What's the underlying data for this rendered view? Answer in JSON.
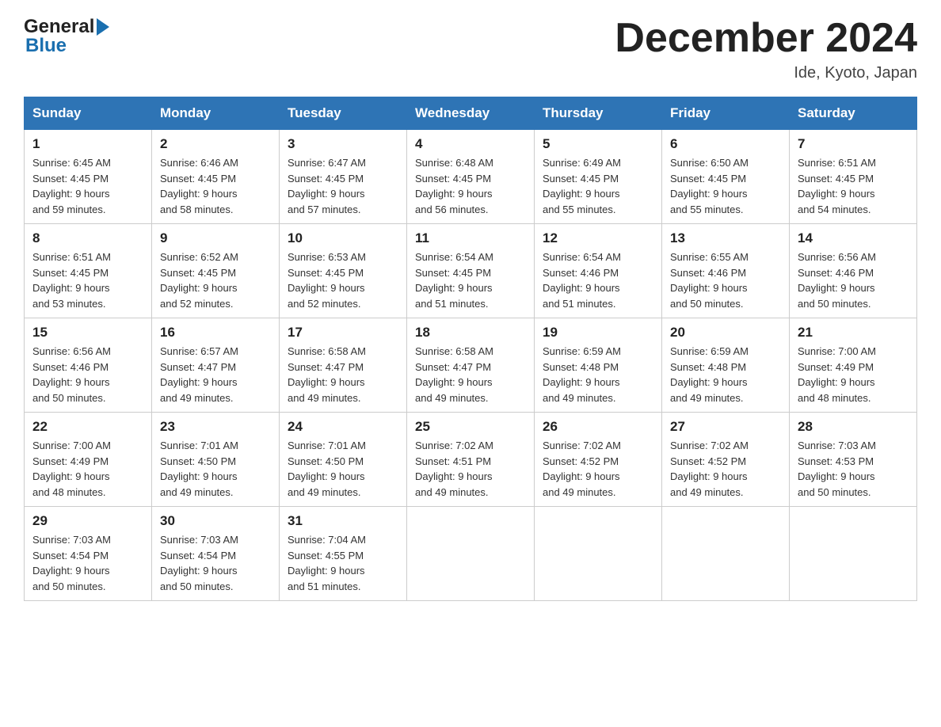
{
  "header": {
    "logo_general": "General",
    "logo_blue": "Blue",
    "title": "December 2024",
    "subtitle": "Ide, Kyoto, Japan"
  },
  "days_of_week": [
    "Sunday",
    "Monday",
    "Tuesday",
    "Wednesday",
    "Thursday",
    "Friday",
    "Saturday"
  ],
  "weeks": [
    [
      {
        "num": "1",
        "info": "Sunrise: 6:45 AM\nSunset: 4:45 PM\nDaylight: 9 hours\nand 59 minutes."
      },
      {
        "num": "2",
        "info": "Sunrise: 6:46 AM\nSunset: 4:45 PM\nDaylight: 9 hours\nand 58 minutes."
      },
      {
        "num": "3",
        "info": "Sunrise: 6:47 AM\nSunset: 4:45 PM\nDaylight: 9 hours\nand 57 minutes."
      },
      {
        "num": "4",
        "info": "Sunrise: 6:48 AM\nSunset: 4:45 PM\nDaylight: 9 hours\nand 56 minutes."
      },
      {
        "num": "5",
        "info": "Sunrise: 6:49 AM\nSunset: 4:45 PM\nDaylight: 9 hours\nand 55 minutes."
      },
      {
        "num": "6",
        "info": "Sunrise: 6:50 AM\nSunset: 4:45 PM\nDaylight: 9 hours\nand 55 minutes."
      },
      {
        "num": "7",
        "info": "Sunrise: 6:51 AM\nSunset: 4:45 PM\nDaylight: 9 hours\nand 54 minutes."
      }
    ],
    [
      {
        "num": "8",
        "info": "Sunrise: 6:51 AM\nSunset: 4:45 PM\nDaylight: 9 hours\nand 53 minutes."
      },
      {
        "num": "9",
        "info": "Sunrise: 6:52 AM\nSunset: 4:45 PM\nDaylight: 9 hours\nand 52 minutes."
      },
      {
        "num": "10",
        "info": "Sunrise: 6:53 AM\nSunset: 4:45 PM\nDaylight: 9 hours\nand 52 minutes."
      },
      {
        "num": "11",
        "info": "Sunrise: 6:54 AM\nSunset: 4:45 PM\nDaylight: 9 hours\nand 51 minutes."
      },
      {
        "num": "12",
        "info": "Sunrise: 6:54 AM\nSunset: 4:46 PM\nDaylight: 9 hours\nand 51 minutes."
      },
      {
        "num": "13",
        "info": "Sunrise: 6:55 AM\nSunset: 4:46 PM\nDaylight: 9 hours\nand 50 minutes."
      },
      {
        "num": "14",
        "info": "Sunrise: 6:56 AM\nSunset: 4:46 PM\nDaylight: 9 hours\nand 50 minutes."
      }
    ],
    [
      {
        "num": "15",
        "info": "Sunrise: 6:56 AM\nSunset: 4:46 PM\nDaylight: 9 hours\nand 50 minutes."
      },
      {
        "num": "16",
        "info": "Sunrise: 6:57 AM\nSunset: 4:47 PM\nDaylight: 9 hours\nand 49 minutes."
      },
      {
        "num": "17",
        "info": "Sunrise: 6:58 AM\nSunset: 4:47 PM\nDaylight: 9 hours\nand 49 minutes."
      },
      {
        "num": "18",
        "info": "Sunrise: 6:58 AM\nSunset: 4:47 PM\nDaylight: 9 hours\nand 49 minutes."
      },
      {
        "num": "19",
        "info": "Sunrise: 6:59 AM\nSunset: 4:48 PM\nDaylight: 9 hours\nand 49 minutes."
      },
      {
        "num": "20",
        "info": "Sunrise: 6:59 AM\nSunset: 4:48 PM\nDaylight: 9 hours\nand 49 minutes."
      },
      {
        "num": "21",
        "info": "Sunrise: 7:00 AM\nSunset: 4:49 PM\nDaylight: 9 hours\nand 48 minutes."
      }
    ],
    [
      {
        "num": "22",
        "info": "Sunrise: 7:00 AM\nSunset: 4:49 PM\nDaylight: 9 hours\nand 48 minutes."
      },
      {
        "num": "23",
        "info": "Sunrise: 7:01 AM\nSunset: 4:50 PM\nDaylight: 9 hours\nand 49 minutes."
      },
      {
        "num": "24",
        "info": "Sunrise: 7:01 AM\nSunset: 4:50 PM\nDaylight: 9 hours\nand 49 minutes."
      },
      {
        "num": "25",
        "info": "Sunrise: 7:02 AM\nSunset: 4:51 PM\nDaylight: 9 hours\nand 49 minutes."
      },
      {
        "num": "26",
        "info": "Sunrise: 7:02 AM\nSunset: 4:52 PM\nDaylight: 9 hours\nand 49 minutes."
      },
      {
        "num": "27",
        "info": "Sunrise: 7:02 AM\nSunset: 4:52 PM\nDaylight: 9 hours\nand 49 minutes."
      },
      {
        "num": "28",
        "info": "Sunrise: 7:03 AM\nSunset: 4:53 PM\nDaylight: 9 hours\nand 50 minutes."
      }
    ],
    [
      {
        "num": "29",
        "info": "Sunrise: 7:03 AM\nSunset: 4:54 PM\nDaylight: 9 hours\nand 50 minutes."
      },
      {
        "num": "30",
        "info": "Sunrise: 7:03 AM\nSunset: 4:54 PM\nDaylight: 9 hours\nand 50 minutes."
      },
      {
        "num": "31",
        "info": "Sunrise: 7:04 AM\nSunset: 4:55 PM\nDaylight: 9 hours\nand 51 minutes."
      },
      {
        "num": "",
        "info": ""
      },
      {
        "num": "",
        "info": ""
      },
      {
        "num": "",
        "info": ""
      },
      {
        "num": "",
        "info": ""
      }
    ]
  ]
}
